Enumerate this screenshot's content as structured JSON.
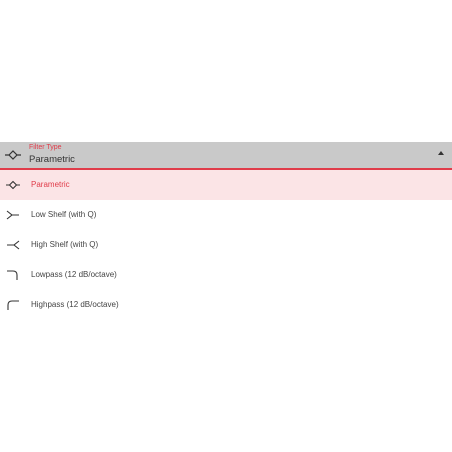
{
  "select": {
    "label": "Filter Type",
    "value": "Parametric",
    "icon": "parametric-icon"
  },
  "options": [
    {
      "label": "Parametric",
      "icon": "parametric-icon",
      "selected": true
    },
    {
      "label": "Low Shelf (with Q)",
      "icon": "low-shelf-icon",
      "selected": false
    },
    {
      "label": "High Shelf (with Q)",
      "icon": "high-shelf-icon",
      "selected": false
    },
    {
      "label": "Lowpass (12 dB/octave)",
      "icon": "lowpass-icon",
      "selected": false
    },
    {
      "label": "Highpass (12 dB/octave)",
      "icon": "highpass-icon",
      "selected": false
    }
  ],
  "colors": {
    "accent": "#e03c4a",
    "field_background": "#c9c9c9",
    "selected_background": "#fbe4e6"
  }
}
